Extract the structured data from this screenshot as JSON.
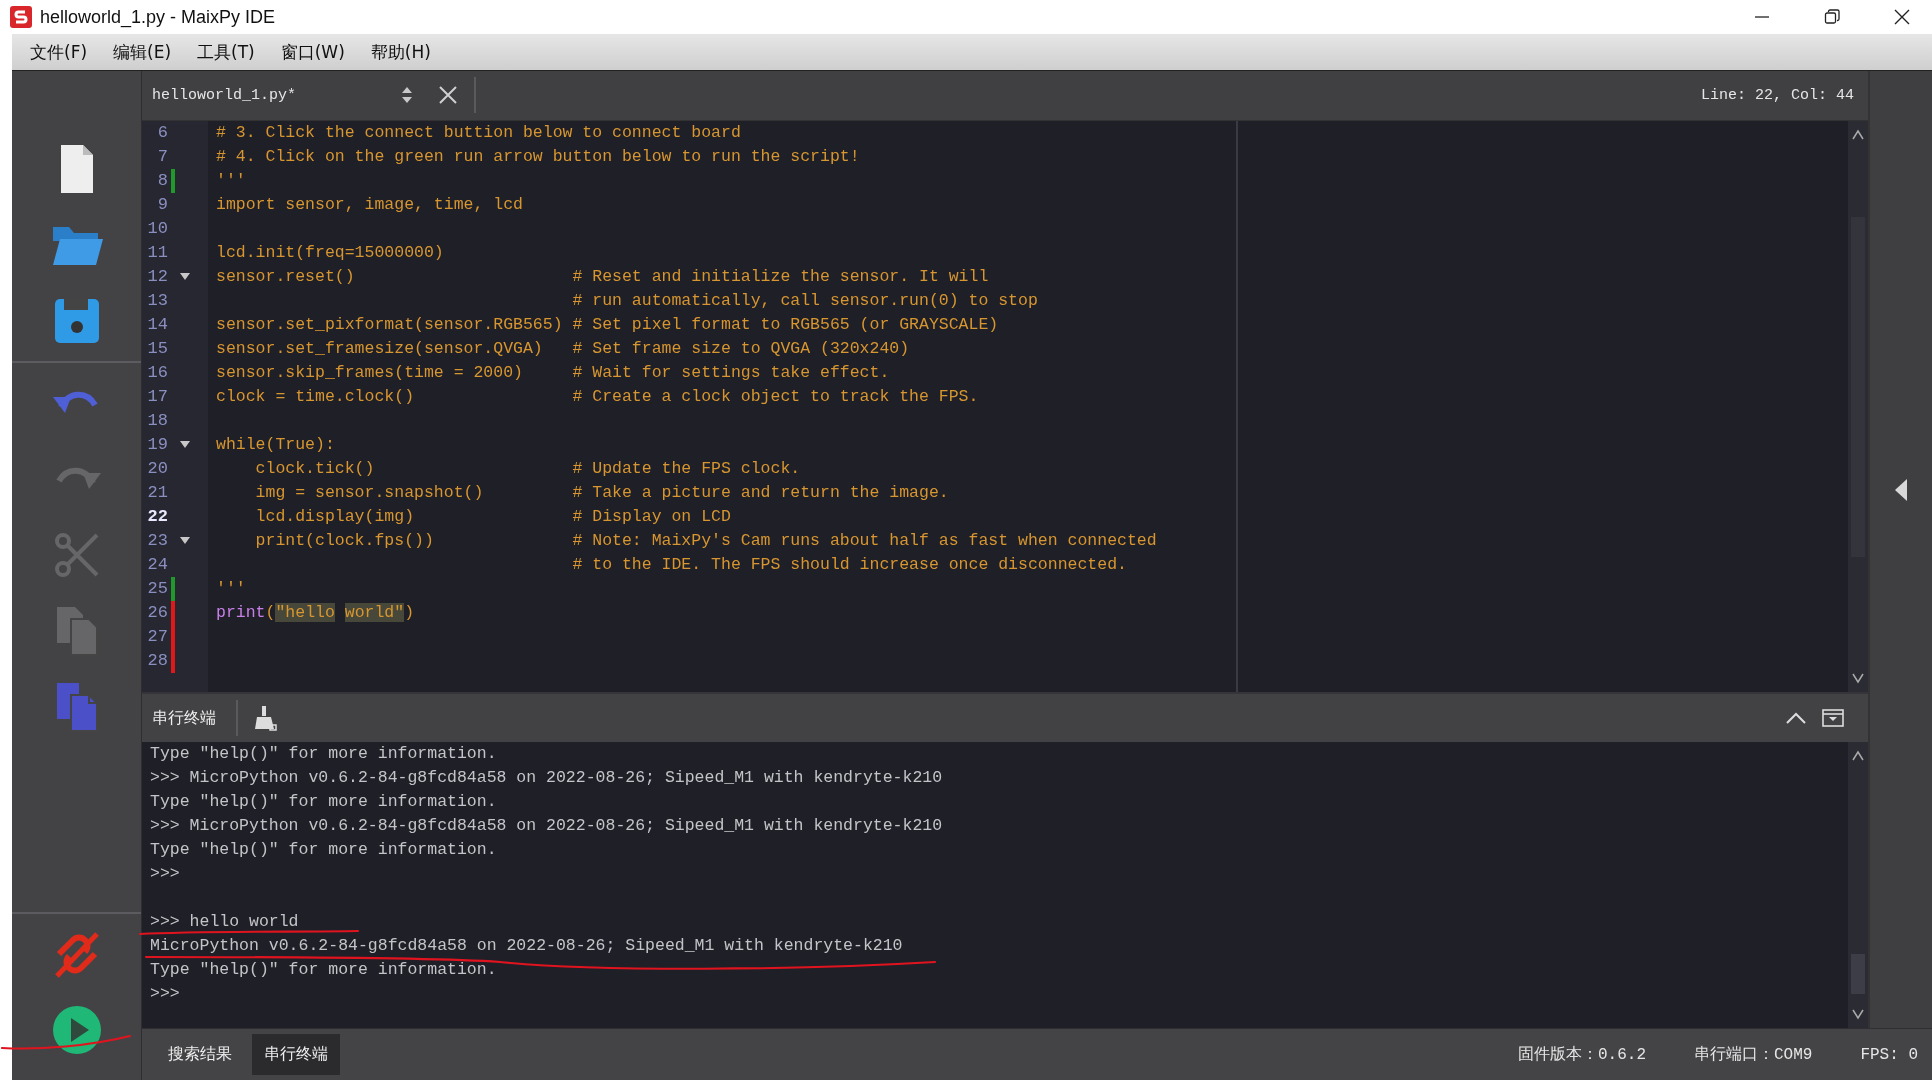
{
  "window": {
    "title": "helloworld_1.py - MaixPy IDE"
  },
  "menu": [
    {
      "label": "文件(F)"
    },
    {
      "label": "编辑(E)"
    },
    {
      "label": "工具(T)"
    },
    {
      "label": "窗口(W)"
    },
    {
      "label": "帮助(H)"
    }
  ],
  "toolbar": {
    "groups": [
      [
        {
          "kind": "new",
          "disabled": false
        },
        {
          "kind": "open",
          "disabled": false
        },
        {
          "kind": "save",
          "disabled": false
        }
      ],
      [
        {
          "kind": "undo",
          "disabled": false
        },
        {
          "kind": "redo",
          "disabled": true
        },
        {
          "kind": "cut",
          "disabled": true
        },
        {
          "kind": "copy",
          "disabled": true
        },
        {
          "kind": "paste",
          "disabled": false
        }
      ],
      [
        {
          "kind": "disconnect",
          "disabled": false
        },
        {
          "kind": "run",
          "disabled": false
        }
      ]
    ]
  },
  "editor": {
    "file": "helloworld_1.py*",
    "position": "Line: 22, Col: 44",
    "lines": [
      {
        "number": "6",
        "code": "# 3. Click the connect buttion below to connect board",
        "folding": false,
        "current": false
      },
      {
        "number": "7",
        "code": "# 4. Click on the green run arrow button below to run the script!",
        "folding": false,
        "current": false
      },
      {
        "number": "8",
        "code": "'''",
        "folding": false,
        "current": false,
        "color": "#1f9a2a"
      },
      {
        "number": "9",
        "code": "import sensor, image, time, lcd",
        "folding": false,
        "current": false
      },
      {
        "number": "10",
        "folding": false,
        "current": false
      },
      {
        "number": "11",
        "code": "lcd.init(freq=15000000)",
        "folding": false,
        "current": false
      },
      {
        "number": "12",
        "code": "sensor.reset()",
        "comment": "# Reset and initialize the sensor. It will",
        "folding": true,
        "current": false
      },
      {
        "number": "13",
        "comment": "# run automatically, call sensor.run(0) to stop",
        "folding": false,
        "current": false
      },
      {
        "number": "14",
        "code": "sensor.set_pixformat(sensor.RGB565)",
        "comment": "# Set pixel format to RGB565 (or GRAYSCALE)",
        "folding": false,
        "current": false
      },
      {
        "number": "15",
        "code": "sensor.set_framesize(sensor.QVGA)",
        "comment": "# Set frame size to QVGA (320x240)",
        "folding": false,
        "current": false
      },
      {
        "number": "16",
        "code": "sensor.skip_frames(time = 2000)",
        "comment": "# Wait for settings take effect.",
        "folding": false,
        "current": false
      },
      {
        "number": "17",
        "code": "clock = time.clock()",
        "comment": "# Create a clock object to track the FPS.",
        "folding": false,
        "current": false
      },
      {
        "number": "18",
        "folding": false,
        "current": false
      },
      {
        "number": "19",
        "code": "while(True):",
        "folding": true,
        "current": false
      },
      {
        "number": "20",
        "code": "    clock.tick()",
        "comment": "# Update the FPS clock.",
        "folding": false,
        "current": false
      },
      {
        "number": "21",
        "code": "    img = sensor.snapshot()",
        "comment": "# Take a picture and return the image.",
        "folding": false,
        "current": false
      },
      {
        "number": "22",
        "code": "    lcd.display(img)",
        "comment": "# Display on LCD",
        "folding": false,
        "current": true
      },
      {
        "number": "23",
        "code": "    print(clock.fps())",
        "comment": "# Note: MaixPy's Cam runs about half as fast when connected",
        "folding": true,
        "current": false
      },
      {
        "number": "24",
        "comment": "# to the IDE. The FPS should increase once disconnected.",
        "folding": false,
        "current": false
      },
      {
        "number": "25",
        "code": "'''",
        "folding": false,
        "current": false,
        "color": "#1f9a2a"
      },
      {
        "number": "26",
        "tokens": [
          {
            "text": "print",
            "kind": "builtin"
          },
          {
            "text": "(",
            "kind": "plain"
          },
          {
            "text": "\"hello world\"",
            "kind": "word-matches"
          },
          {
            "text": ")",
            "kind": "plain"
          }
        ],
        "folding": false,
        "current": false,
        "color": "#e01818"
      },
      {
        "number": "27",
        "folding": false,
        "current": false,
        "color": "#e01818"
      },
      {
        "number": "28",
        "folding": false,
        "current": false,
        "color": "#e01818"
      }
    ]
  },
  "terminal": {
    "title": "串行终端",
    "blocks": [
      [
        "Type \"help()\" for more information.",
        ">>> MicroPython v0.6.2-84-g8fcd84a58 on 2022-08-26; Sipeed_M1 with kendryte-k210",
        "Type \"help()\" for more information.",
        ">>> MicroPython v0.6.2-84-g8fcd84a58 on 2022-08-26; Sipeed_M1 with kendryte-k210",
        "Type \"help()\" for more information.",
        ">>>"
      ],
      [
        ">>> hello world",
        "MicroPython v0.6.2-84-g8fcd84a58 on 2022-08-26; Sipeed_M1 with kendryte-k210",
        "Type \"help()\" for more information.",
        ">>>"
      ]
    ]
  },
  "status_bar": {
    "tabs": [
      {
        "label": "搜索结果",
        "selected": false
      },
      {
        "label": "串行终端",
        "selected": true
      }
    ],
    "items": [
      "固件版本：0.6.2",
      "串行端口：COM9",
      "FPS: 0"
    ]
  },
  "pen_marks": [
    {
      "kind": "underline"
    },
    {
      "kind": "wavy-underline"
    },
    {
      "kind": "stroke"
    }
  ]
}
